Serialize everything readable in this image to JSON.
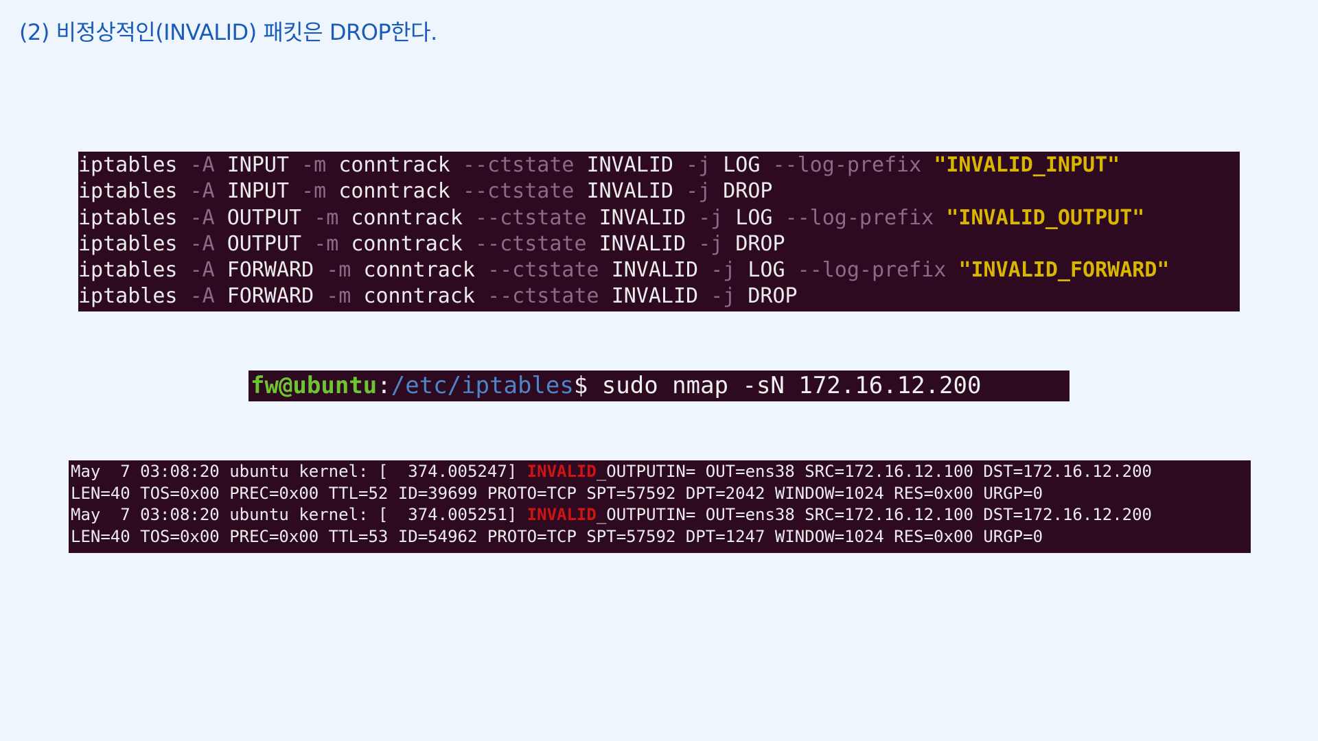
{
  "heading": "(2) 비정상적인(INVALID) 패킷은 DROP한다.",
  "rules": [
    {
      "parts": [
        {
          "t": "iptables ",
          "c": "cmd"
        },
        {
          "t": "-A ",
          "c": "flag"
        },
        {
          "t": "INPUT ",
          "c": "cmd"
        },
        {
          "t": "-m ",
          "c": "flag"
        },
        {
          "t": "conntrack ",
          "c": "cmd"
        },
        {
          "t": "--ctstate ",
          "c": "flag"
        },
        {
          "t": "INVALID ",
          "c": "cmd"
        },
        {
          "t": "-j ",
          "c": "flag"
        },
        {
          "t": "LOG ",
          "c": "cmd"
        },
        {
          "t": "--log-prefix ",
          "c": "flag"
        },
        {
          "t": "\"INVALID_INPUT\"",
          "c": "str"
        }
      ]
    },
    {
      "parts": [
        {
          "t": "iptables ",
          "c": "cmd"
        },
        {
          "t": "-A ",
          "c": "flag"
        },
        {
          "t": "INPUT ",
          "c": "cmd"
        },
        {
          "t": "-m ",
          "c": "flag"
        },
        {
          "t": "conntrack ",
          "c": "cmd"
        },
        {
          "t": "--ctstate ",
          "c": "flag"
        },
        {
          "t": "INVALID ",
          "c": "cmd"
        },
        {
          "t": "-j ",
          "c": "flag"
        },
        {
          "t": "DROP",
          "c": "cmd"
        }
      ]
    },
    {
      "parts": [
        {
          "t": "iptables ",
          "c": "cmd"
        },
        {
          "t": "-A ",
          "c": "flag"
        },
        {
          "t": "OUTPUT ",
          "c": "cmd"
        },
        {
          "t": "-m ",
          "c": "flag"
        },
        {
          "t": "conntrack ",
          "c": "cmd"
        },
        {
          "t": "--ctstate ",
          "c": "flag"
        },
        {
          "t": "INVALID ",
          "c": "cmd"
        },
        {
          "t": "-j ",
          "c": "flag"
        },
        {
          "t": "LOG ",
          "c": "cmd"
        },
        {
          "t": "--log-prefix ",
          "c": "flag"
        },
        {
          "t": "\"INVALID_OUTPUT\"",
          "c": "str"
        }
      ]
    },
    {
      "parts": [
        {
          "t": "iptables ",
          "c": "cmd"
        },
        {
          "t": "-A ",
          "c": "flag"
        },
        {
          "t": "OUTPUT ",
          "c": "cmd"
        },
        {
          "t": "-m ",
          "c": "flag"
        },
        {
          "t": "conntrack ",
          "c": "cmd"
        },
        {
          "t": "--ctstate ",
          "c": "flag"
        },
        {
          "t": "INVALID ",
          "c": "cmd"
        },
        {
          "t": "-j ",
          "c": "flag"
        },
        {
          "t": "DROP",
          "c": "cmd"
        }
      ]
    },
    {
      "parts": [
        {
          "t": "iptables ",
          "c": "cmd"
        },
        {
          "t": "-A ",
          "c": "flag"
        },
        {
          "t": "FORWARD ",
          "c": "cmd"
        },
        {
          "t": "-m ",
          "c": "flag"
        },
        {
          "t": "conntrack ",
          "c": "cmd"
        },
        {
          "t": "--ctstate ",
          "c": "flag"
        },
        {
          "t": "INVALID ",
          "c": "cmd"
        },
        {
          "t": "-j ",
          "c": "flag"
        },
        {
          "t": "LOG ",
          "c": "cmd"
        },
        {
          "t": "--log-prefix ",
          "c": "flag"
        },
        {
          "t": "\"INVALID_FORWARD\"",
          "c": "str"
        }
      ]
    },
    {
      "parts": [
        {
          "t": "iptables ",
          "c": "cmd"
        },
        {
          "t": "-A ",
          "c": "flag"
        },
        {
          "t": "FORWARD ",
          "c": "cmd"
        },
        {
          "t": "-m ",
          "c": "flag"
        },
        {
          "t": "conntrack ",
          "c": "cmd"
        },
        {
          "t": "--ctstate ",
          "c": "flag"
        },
        {
          "t": "INVALID ",
          "c": "cmd"
        },
        {
          "t": "-j ",
          "c": "flag"
        },
        {
          "t": "DROP",
          "c": "cmd"
        }
      ]
    }
  ],
  "prompt": {
    "user_host": "fw@ubuntu",
    "sep": ":",
    "path": "/etc/iptables",
    "dollar": "$",
    "command": " sudo nmap -sN 172.16.12.200"
  },
  "logs": [
    {
      "parts": [
        {
          "t": "May  7 03:08:20 ubuntu kernel: [  374.005247] ",
          "c": "n"
        },
        {
          "t": "INVALID",
          "c": "r"
        },
        {
          "t": "_OUTPUTIN= OUT=ens38 SRC=172.16.12.100 DST=172.16.12.200",
          "c": "n"
        }
      ]
    },
    {
      "parts": [
        {
          "t": "LEN=40 TOS=0x00 PREC=0x00 TTL=52 ID=39699 PROTO=TCP SPT=57592 DPT=2042 WINDOW=1024 RES=0x00 URGP=0",
          "c": "n"
        }
      ]
    },
    {
      "parts": [
        {
          "t": "May  7 03:08:20 ubuntu kernel: [  374.005251] ",
          "c": "n"
        },
        {
          "t": "INVALID",
          "c": "r"
        },
        {
          "t": "_OUTPUTIN= OUT=ens38 SRC=172.16.12.100 DST=172.16.12.200",
          "c": "n"
        }
      ]
    },
    {
      "parts": [
        {
          "t": "LEN=40 TOS=0x00 PREC=0x00 TTL=53 ID=54962 PROTO=TCP SPT=57592 DPT=1247 WINDOW=1024 RES=0x00 URGP=0",
          "c": "n"
        }
      ]
    }
  ],
  "colors": {
    "background": "#eef5fd",
    "heading": "#1a5bb8",
    "terminal_bg": "#2e0a20",
    "terminal_text": "#ececec",
    "flag_text": "#8a6b8a",
    "string_text": "#d9b600",
    "prompt_user": "#6ec531",
    "prompt_path": "#4e84c9",
    "log_highlight": "#d01414"
  }
}
